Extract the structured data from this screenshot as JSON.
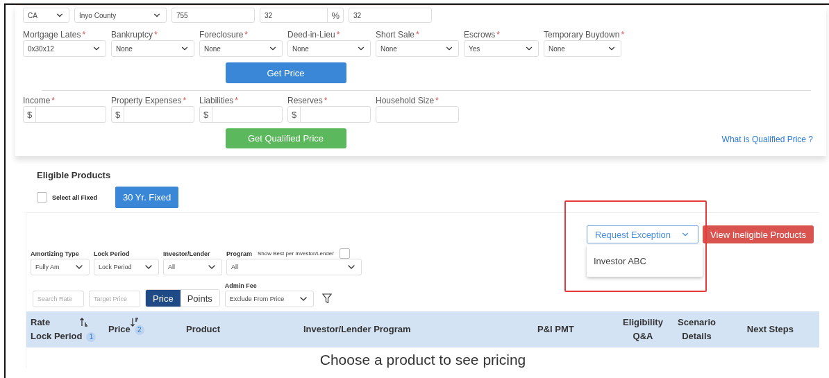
{
  "location_row": [
    {
      "kind": "select",
      "value": "CA"
    },
    {
      "kind": "select",
      "value": "Inyo County"
    },
    {
      "kind": "input",
      "value": "755"
    },
    {
      "kind": "input",
      "value": "32",
      "suffix": "%"
    },
    {
      "kind": "input",
      "value": "32"
    }
  ],
  "credit_fields": [
    {
      "label": "Mortgage Lates",
      "required_mark": "*",
      "value": "0x30x12"
    },
    {
      "label": "Bankruptcy",
      "required_mark": "*",
      "value": "None"
    },
    {
      "label": "Foreclosure",
      "required_mark": "*",
      "value": "None"
    },
    {
      "label": "Deed-in-Lieu",
      "required_mark": "*",
      "value": "None"
    },
    {
      "label": "Short Sale",
      "required_mark": "*",
      "value": "None"
    },
    {
      "label": "Escrows",
      "required_mark": "*",
      "value": "Yes"
    },
    {
      "label": "Temporary Buydown",
      "required_mark": "*",
      "value": "None"
    }
  ],
  "get_price_button": "Get Price",
  "qualification_fields": [
    {
      "label": "Income",
      "required_mark": "*",
      "prefix": "$"
    },
    {
      "label": "Property Expenses",
      "required_mark": "*",
      "prefix": "$"
    },
    {
      "label": "Liabilities",
      "required_mark": "*",
      "prefix": "$"
    },
    {
      "label": "Reserves",
      "required_mark": "*",
      "prefix": "$"
    },
    {
      "label": "Household Size",
      "required_mark": "*"
    }
  ],
  "get_qualified_price_button": "Get Qualified Price",
  "qualified_price_link": "What is Qualified Price ?",
  "eligible_products": {
    "title": "Eligible Products",
    "select_all": {
      "label": "Select all Fixed",
      "checked": false
    },
    "product_buttons": [
      {
        "label": "30 Yr. Fixed",
        "selected": true
      }
    ]
  },
  "request_exception": {
    "label": "Request Exception",
    "expanded": true,
    "menu_items": [
      "Investor ABC"
    ]
  },
  "view_ineligible_button": "View Ineligible Products",
  "filters": [
    {
      "label": "Amortizing Type",
      "value": "Fully Am"
    },
    {
      "label": "Lock Period",
      "value": "Lock Period"
    },
    {
      "label": "Investor/Lender",
      "value": "All"
    },
    {
      "label": "Program",
      "value": "All"
    }
  ],
  "show_best": {
    "label": "Show Best per Investor/Lender",
    "checked": false
  },
  "search_rate": {
    "placeholder": "Search Rate"
  },
  "target_price": {
    "placeholder": "Target Price"
  },
  "price_mode": [
    {
      "label": "Price",
      "selected": true
    },
    {
      "label": "Points",
      "selected": false
    }
  ],
  "admin_fee": {
    "label": "Admin Fee",
    "value": "Exclude From Price"
  },
  "table": {
    "columns": [
      {
        "kind": "ascending",
        "line1": "Rate",
        "line2": "Lock Period",
        "badge": "1"
      },
      {
        "kind": "descending",
        "line2": "Price",
        "badge": "2"
      },
      {
        "kind": "plain",
        "line2": "Product"
      },
      {
        "kind": "plain",
        "line2": "Investor/Lender Program"
      },
      {
        "kind": "plain",
        "line2": "P&I PMT"
      },
      {
        "kind": "plain",
        "line1": "Eligibility",
        "line2": "Q&A"
      },
      {
        "kind": "plain",
        "line1": "Scenario",
        "line2": "Details"
      },
      {
        "kind": "plain",
        "line2": "Next Steps"
      }
    ]
  },
  "empty_message": "Choose a product to see pricing"
}
